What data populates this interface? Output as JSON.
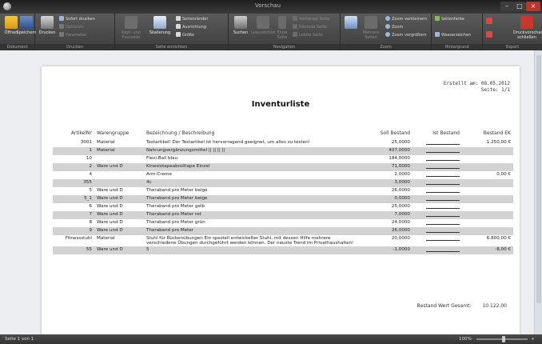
{
  "window": {
    "title": "Vorschau",
    "min": "–",
    "max": "□",
    "close": "×"
  },
  "ribbon": {
    "groups": {
      "dokument": "Dokument",
      "drucken": "Drucken",
      "seite": "Seite einrichten",
      "navigation": "Navigation",
      "zoom": "Zoom",
      "hintergrund": "Hintergrund",
      "export": "Export"
    },
    "oeffnen": "Öffnen",
    "speichern": "Speichern",
    "drucken": "Drucken",
    "sofort_drucken": "Sofort drucken",
    "optionen": "Optionen",
    "parameter": "Parameter",
    "kopf_fuss": "Kopf- und Fusszeile",
    "skalierung": "Skalierung",
    "seitenraender": "Seitenränder",
    "ausrichtung": "Ausrichtung",
    "groesse": "Größe",
    "suchen": "Suchen",
    "lesezeichen": "Lesezeichen",
    "erste_seite": "Erste Seite",
    "vorherige_seite": "Vorherige Seite",
    "naechste_seite": "Nächste Seite",
    "letzte_seite": "Letzte Seite",
    "mehrere_seiten": "Mehrere Seiten",
    "zoom_verkleinern": "Zoom verkleinern",
    "zoom": "Zoom",
    "zoom_vergroessern": "Zoom vergrößern",
    "seitenfarbe": "Seitenfarbe",
    "wasserzeichen": "Wasserzeichen",
    "export_an": "Exportieren in",
    "email": "E-Mail",
    "schliessen": "Druckvorschau schließen"
  },
  "document": {
    "created": "Erstellt am: 08.05.2012",
    "page": "Seite: 1/1",
    "title": "Inventurliste",
    "columns": [
      "ArtikelNr",
      "Warengruppe",
      "Bezeichnung / Beschreibung",
      "Soll Bestand",
      "Ist Bestand",
      "Bestand EK"
    ],
    "rows": [
      {
        "nr": "3001",
        "gruppe": "Material",
        "beschreibung": "Testartikel! Der Testartikel ist hervorragend geeignet, um alles zu testen!",
        "soll": "25,0000",
        "ek": "1.250,00 €",
        "shaded": false
      },
      {
        "nr": "1",
        "gruppe": "Material",
        "beschreibung": "Nahrungsergänzungsmittel || || || ||",
        "soll": "407,0000",
        "ek": "",
        "shaded": true
      },
      {
        "nr": "10",
        "gruppe": "",
        "beschreibung": "Flexi-Ball blau",
        "soll": "184,0000",
        "ek": "",
        "shaded": false
      },
      {
        "nr": "2",
        "gruppe": "Ware und D",
        "beschreibung": "Kinesiotapeabrolltape Einzel",
        "soll": "71,0000",
        "ek": "",
        "shaded": true
      },
      {
        "nr": "4",
        "gruppe": "",
        "beschreibung": "Arm-Creme",
        "soll": "2,0000",
        "ek": "0,00 €",
        "shaded": false
      },
      {
        "nr": "355",
        "gruppe": "",
        "beschreibung": "4c",
        "soll": "3,0000",
        "ek": "",
        "shaded": true
      },
      {
        "nr": "5",
        "gruppe": "Ware und D",
        "beschreibung": "Theraband pro Meter beige",
        "soll": "26,0000",
        "ek": "",
        "shaded": false
      },
      {
        "nr": "5_1",
        "gruppe": "Ware und D",
        "beschreibung": "Theraband pro Meter beige",
        "soll": "0,0000",
        "ek": "",
        "shaded": true
      },
      {
        "nr": "6",
        "gruppe": "Ware und D",
        "beschreibung": "Theraband pro Meter gelb",
        "soll": "25,0000",
        "ek": "",
        "shaded": false
      },
      {
        "nr": "7",
        "gruppe": "Ware und D",
        "beschreibung": "Theraband pro Meter rot",
        "soll": "7,0000",
        "ek": "",
        "shaded": true
      },
      {
        "nr": "8",
        "gruppe": "Ware und D",
        "beschreibung": "Theraband pro Meter grün",
        "soll": "24,0000",
        "ek": "",
        "shaded": false
      },
      {
        "nr": "9",
        "gruppe": "Ware und D",
        "beschreibung": "Theraband pro Meter",
        "soll": "26,0000",
        "ek": "",
        "shaded": true
      },
      {
        "nr": "Fitnessstuhl",
        "gruppe": "Material",
        "beschreibung": "Stuhl für Rückenübungen Ein speziell entwickelter Stuhl, mit dessen Hilfe mehrere verschiedene Übungen durchgeführt werden können. Der neuste Trend im Privathaushalten!",
        "soll": "20,0000",
        "ek": "6.800,00 €",
        "shaded": false
      },
      {
        "nr": "55",
        "gruppe": "Ware und D",
        "beschreibung": "5",
        "soll": "-1,0000",
        "ek": "-8,00 €",
        "shaded": true
      }
    ],
    "total_label": "Bestand Wert Gesamt:",
    "total_value": "10.122,00"
  },
  "status": {
    "page": "Seite 1 von 1",
    "zoom": "100%",
    "minus": "–",
    "plus": "+"
  }
}
